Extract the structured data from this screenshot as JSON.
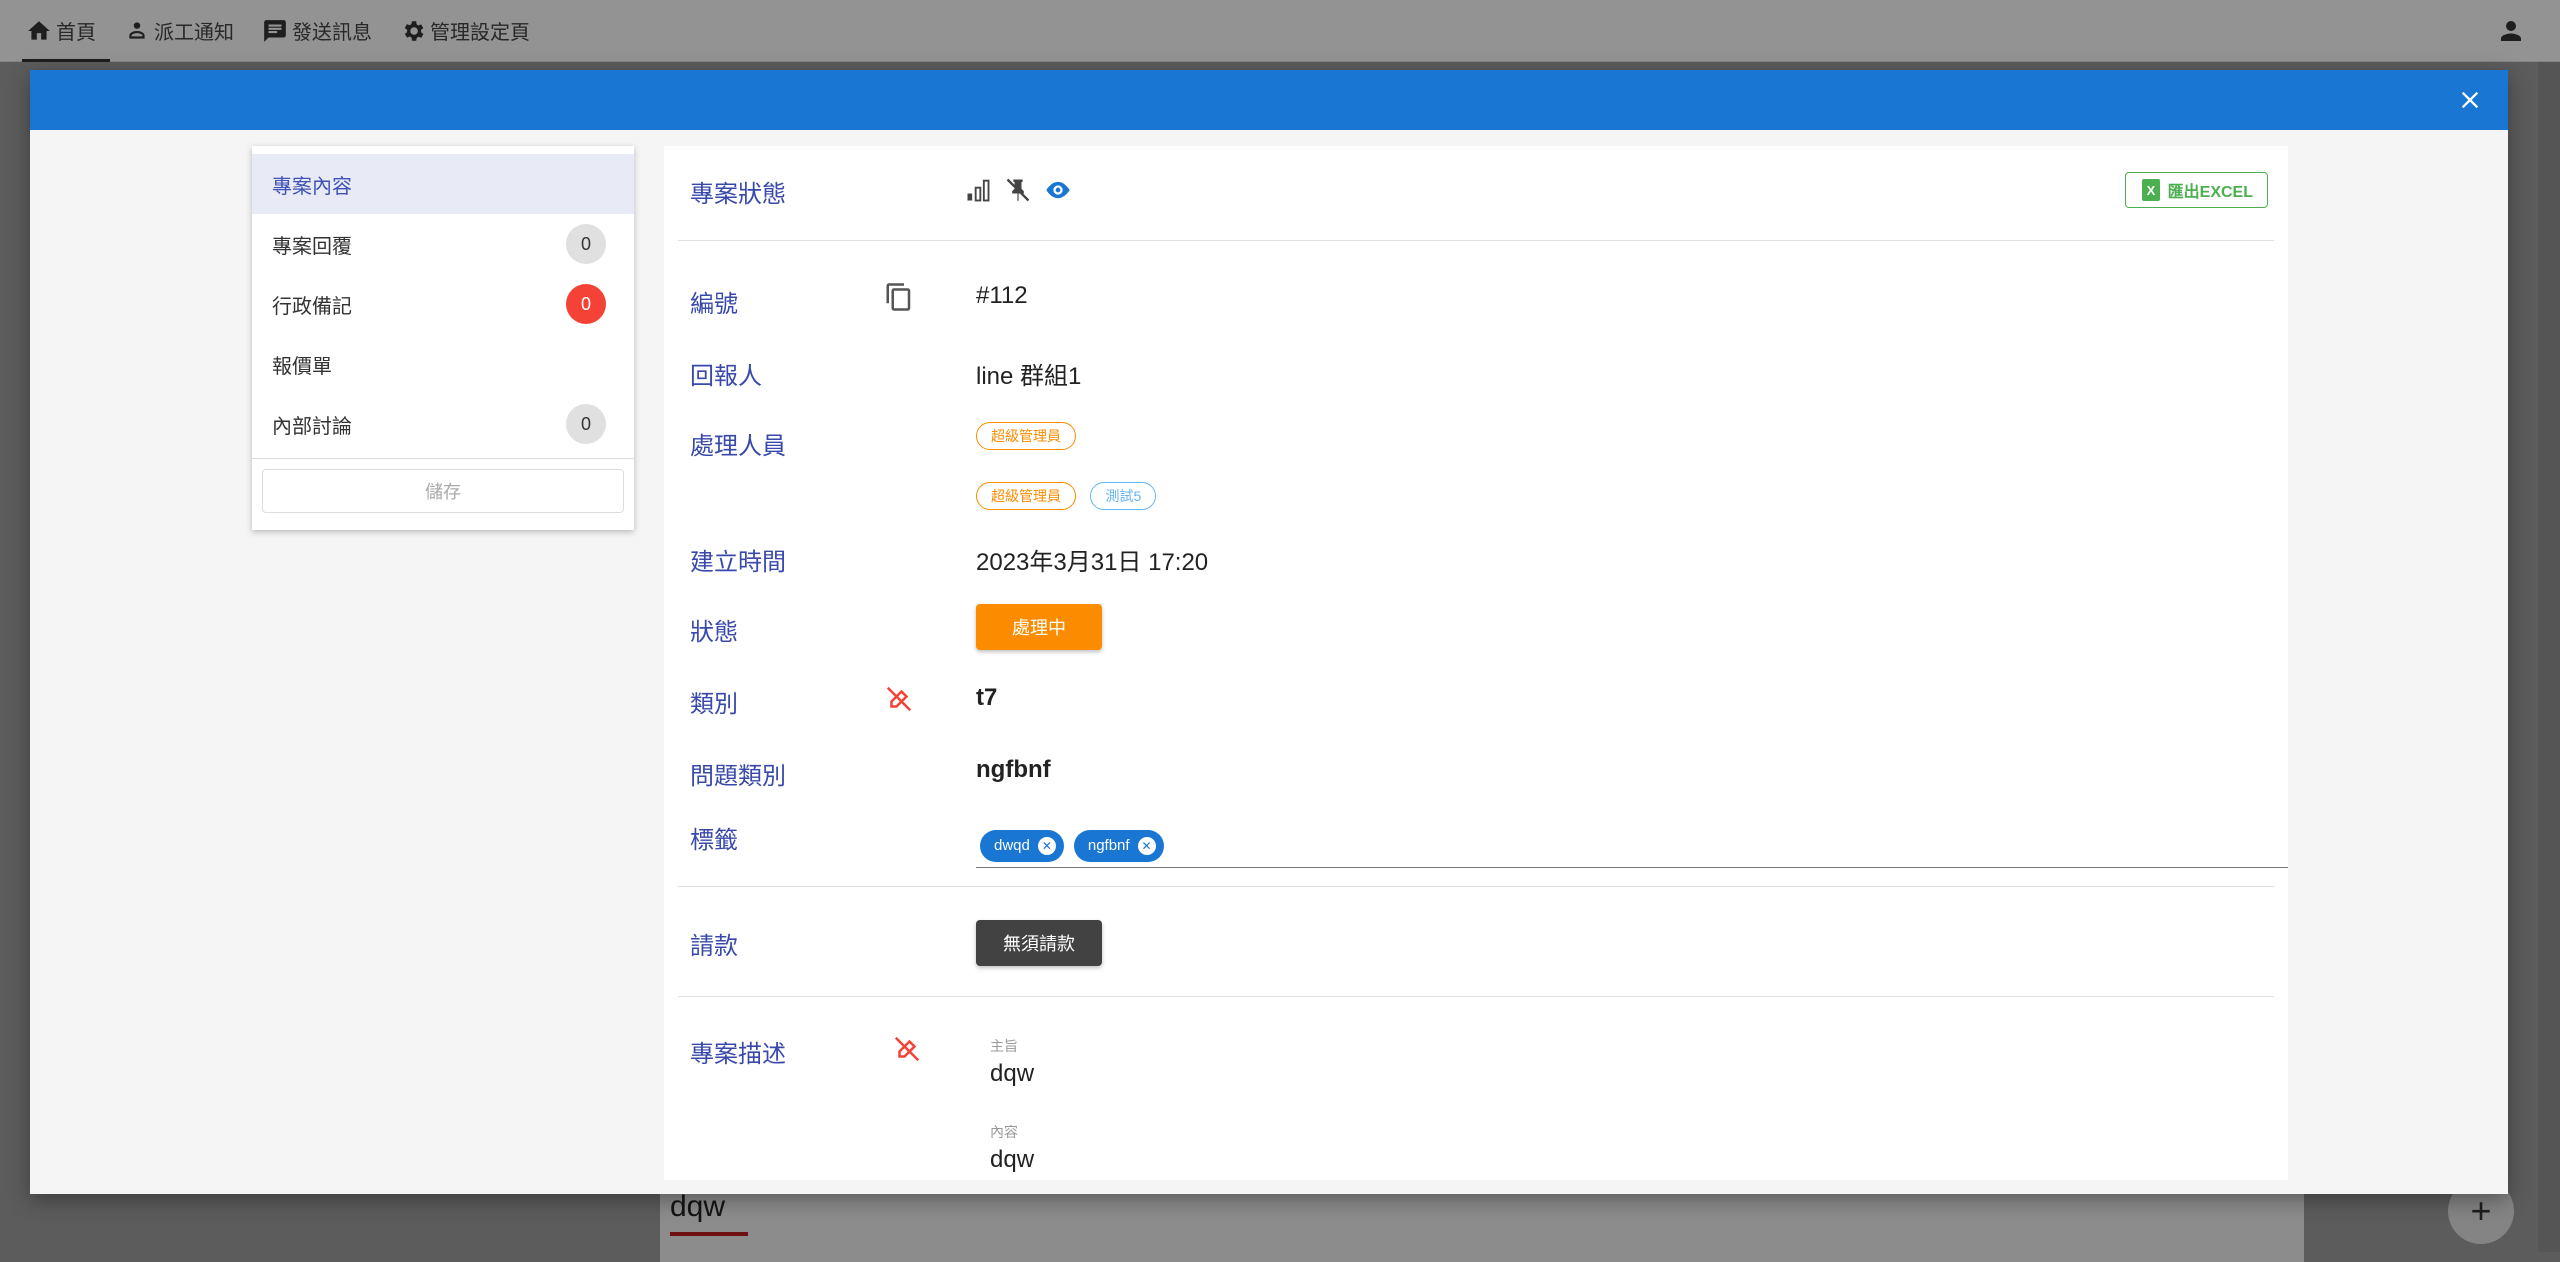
{
  "nav": {
    "items": [
      {
        "label": "首頁",
        "icon": "home-icon"
      },
      {
        "label": "派工通知",
        "icon": "worker-icon"
      },
      {
        "label": "發送訊息",
        "icon": "message-icon"
      },
      {
        "label": "管理設定頁",
        "icon": "gear-icon"
      }
    ],
    "user_icon": "account-icon"
  },
  "background": {
    "text": "dqw",
    "fab_label": "+"
  },
  "dialog": {
    "header_color": "#1976d2"
  },
  "side_menu": {
    "items": [
      {
        "label": "專案內容",
        "badge": null
      },
      {
        "label": "專案回覆",
        "badge": "0"
      },
      {
        "label": "行政備記",
        "badge": "0"
      },
      {
        "label": "報價單",
        "badge": null
      },
      {
        "label": "內部討論",
        "badge": "0"
      }
    ],
    "save_label": "儲存"
  },
  "project": {
    "status_label": "專案狀態",
    "export_label": "匯出EXCEL",
    "id_label": "編號",
    "id_value": "#112",
    "reporter_label": "回報人",
    "reporter_value": "line 群組1",
    "handler_label": "處理人員",
    "handler_row1": [
      "超級管理員"
    ],
    "handler_row2": [
      "超級管理員",
      "測試5"
    ],
    "created_label": "建立時間",
    "created_value": "2023年3月31日 17:20",
    "state_label": "狀態",
    "state_value": "處理中",
    "category_label": "類別",
    "category_value": "t7",
    "issue_label": "問題類別",
    "issue_value": "ngfbnf",
    "tags_label": "標籤",
    "tags": [
      "dwqd",
      "ngfbnf"
    ],
    "billing_label": "請款",
    "billing_value": "無須請款",
    "desc_label": "專案描述",
    "subject_caption": "主旨",
    "subject_value": "dqw",
    "content_caption": "內容",
    "content_value": "dqw"
  },
  "colors": {
    "accent": "#1976d2",
    "label": "#3949ab",
    "orange": "#fb8c00",
    "danger": "#f44336",
    "excel": "#4caf50"
  }
}
